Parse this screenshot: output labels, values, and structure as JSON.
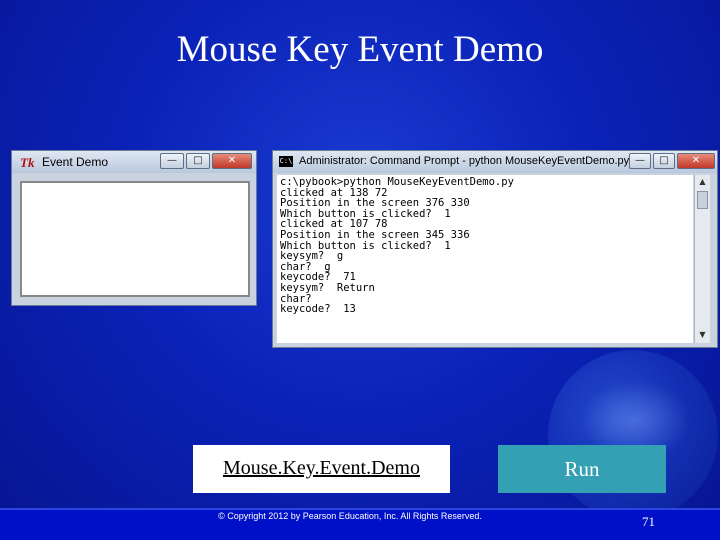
{
  "slide": {
    "title": "Mouse Key Event Demo",
    "link_label": "Mouse.Key.Event.Demo",
    "run_label": "Run",
    "copyright": "© Copyright 2012 by Pearson Education, Inc. All Rights Reserved.",
    "page_number": "71"
  },
  "tk_window": {
    "icon": "Tk",
    "title": "Event Demo",
    "buttons": {
      "minimize": "—",
      "maximize": "□",
      "close": "✕"
    }
  },
  "cmd_window": {
    "icon": "C:\\",
    "title": "Administrator: Command Prompt - python  MouseKeyEventDemo.py",
    "buttons": {
      "minimize": "—",
      "maximize": "□",
      "close": "✕"
    },
    "lines": [
      "c:\\pybook>python MouseKeyEventDemo.py",
      "clicked at 138 72",
      "Position in the screen 376 330",
      "Which button is clicked?  1",
      "clicked at 107 78",
      "Position in the screen 345 336",
      "Which button is clicked?  1",
      "keysym?  g",
      "char?  g",
      "keycode?  71",
      "keysym?  Return",
      "char?",
      "keycode?  13"
    ]
  }
}
